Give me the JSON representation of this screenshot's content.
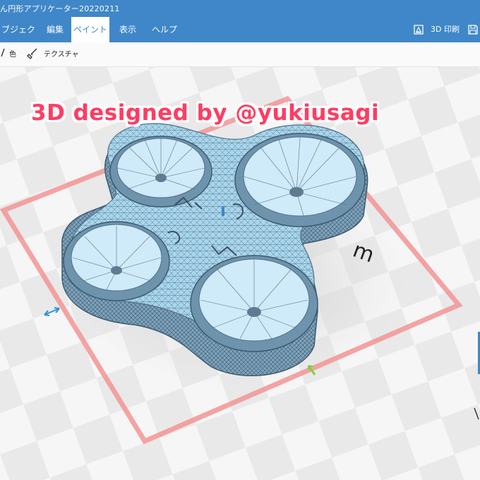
{
  "window": {
    "title": "ん円形アプリケーター20220211"
  },
  "menu": {
    "items": [
      {
        "label": "ブジェクト"
      },
      {
        "label": "編集"
      },
      {
        "label": "ペイント"
      },
      {
        "label": "表示"
      },
      {
        "label": "ヘルプ"
      }
    ],
    "active_index": 2,
    "print_label": "3D 印刷"
  },
  "ribbon": {
    "color_label": "色",
    "texture_label": "テクスチャ"
  },
  "overlay": {
    "caption": "3D designed by @yukiusagi"
  },
  "scene": {
    "model_text": "m",
    "colors": {
      "accent": "#3f87c9",
      "model": "#a9d6ec",
      "mesh": "#4f6f86",
      "bounding_box": "#f39494",
      "caption": "#ff3c62"
    }
  }
}
